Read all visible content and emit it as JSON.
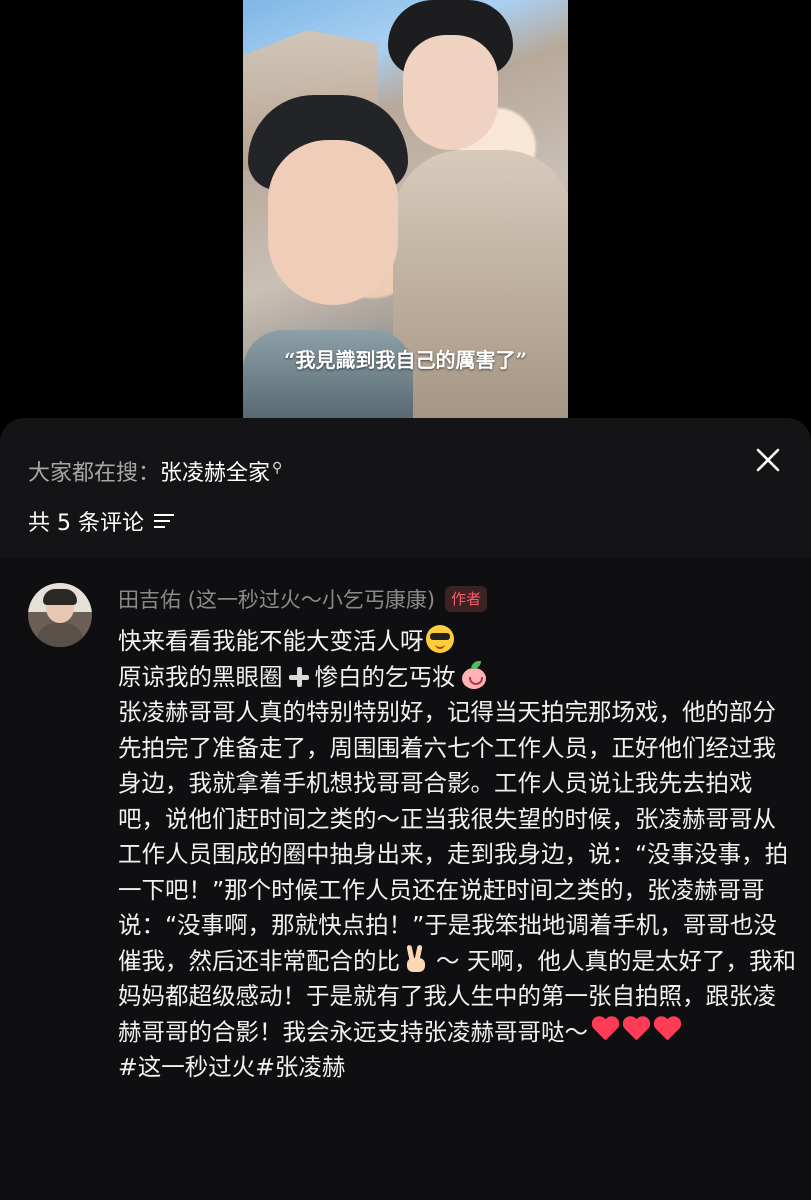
{
  "video": {
    "subtitle": "“我見識到我自己的厲害了”"
  },
  "sheet": {
    "search_hint_label": "大家都在搜：",
    "search_hint_keyword": "张凌赫全家",
    "comment_count_label": "共 5 条评论"
  },
  "comment": {
    "username": "田吉佑 (这一秒过火～小乞丐康康)",
    "badge": "作者",
    "line1": "快来看看我能不能大变活人呀",
    "line2a": "原谅我的黑眼圈",
    "line2b": "惨白的乞丐妆",
    "para_a": "张凌赫哥哥人真的特别特别好，记得当天拍完那场戏，他的部分先拍完了准备走了，周围围着六七个工作人员，正好他们经过我身边，我就拿着手机想找哥哥合影。工作人员说让我先去拍戏吧，说他们赶时间之类的～正当我很失望的时候，张凌赫哥哥从工作人员围成的圈中抽身出来，走到我身边，说：“没事没事，拍一下吧！”那个时候工作人员还在说赶时间之类的，张凌赫哥哥说：“没事啊，那就快点拍！”于是我笨拙地调着手机，哥哥也没催我，然后还非常配合的比",
    "para_b": "～ 天啊，他人真的是太好了，我和妈妈都超级感动！于是就有了我人生中的第一张自拍照，跟张凌赫哥哥的合影！我会永远支持张凌赫哥哥哒～",
    "hashtags": "#这一秒过火#张凌赫"
  },
  "icons": {
    "close": "close-icon",
    "search": "search-icon",
    "sort": "sort-icon",
    "emoji_1": "sunglasses-emoji-icon",
    "emoji_2": "plus-icon",
    "emoji_3": "peach-emoji-icon",
    "emoji_4": "victory-hand-icon",
    "emoji_5": "heart-icon"
  },
  "colors": {
    "author_badge": "#ff5a6a",
    "heart": "#ff3b55",
    "sheet_bg": "#141416",
    "comment_bg": "#0f0f11"
  }
}
